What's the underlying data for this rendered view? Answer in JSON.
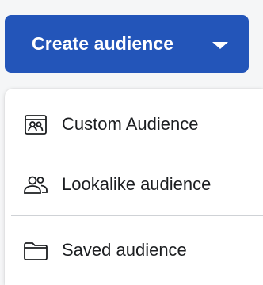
{
  "create_button": {
    "label": "Create audience",
    "color": "#2355b9",
    "icon": "chevron-down-icon"
  },
  "menu": {
    "items": [
      {
        "label": "Custom Audience",
        "icon": "custom-audience-icon"
      },
      {
        "label": "Lookalike audience",
        "icon": "people-icon"
      },
      {
        "label": "Saved audience",
        "icon": "folder-icon"
      }
    ]
  }
}
